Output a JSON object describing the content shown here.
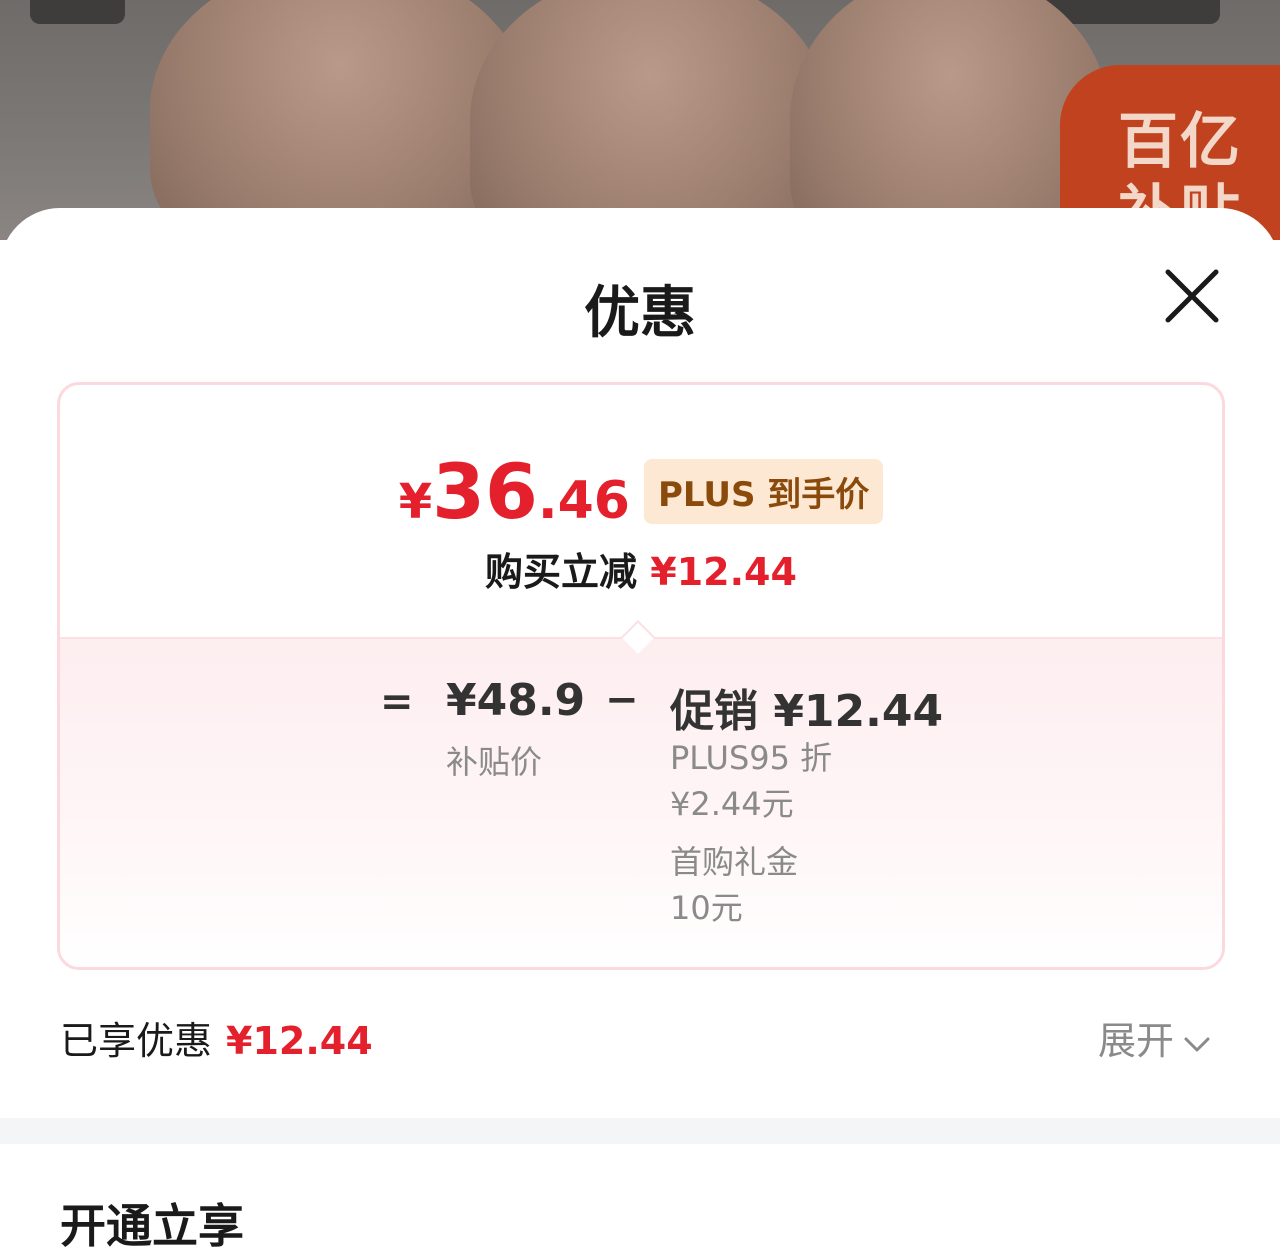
{
  "background": {
    "badge_line1": "百亿",
    "badge_line2": "补贴"
  },
  "sheet": {
    "title": "优惠",
    "close_icon": "close-icon"
  },
  "price_card": {
    "final_price_yen": "¥",
    "final_price_int": "36",
    "final_price_dec": ".46",
    "plus_tag": "PLUS 到手价",
    "instant_off_label": "购买立减",
    "instant_off_amount": "¥12.44",
    "equals": "=",
    "minus": "−",
    "subsidy_price": "¥48.9",
    "subsidy_label": "补贴价",
    "promo_title": "促销 ¥12.44",
    "promo_items": [
      {
        "name": "PLUS95 折",
        "amount": "¥2.44元"
      },
      {
        "name": "首购礼金",
        "amount": "10元"
      }
    ]
  },
  "summary": {
    "enjoyed_label": "已享优惠",
    "enjoyed_amount": "¥12.44",
    "expand_label": "展开",
    "expand_icon": "chevron-down-icon"
  },
  "next_section": {
    "title": "开通立享"
  },
  "colors": {
    "accent_red": "#e4202d",
    "plus_tag_bg": "#fde8d3",
    "plus_tag_text": "#8a4a0c",
    "card_border": "#fbd9df"
  }
}
